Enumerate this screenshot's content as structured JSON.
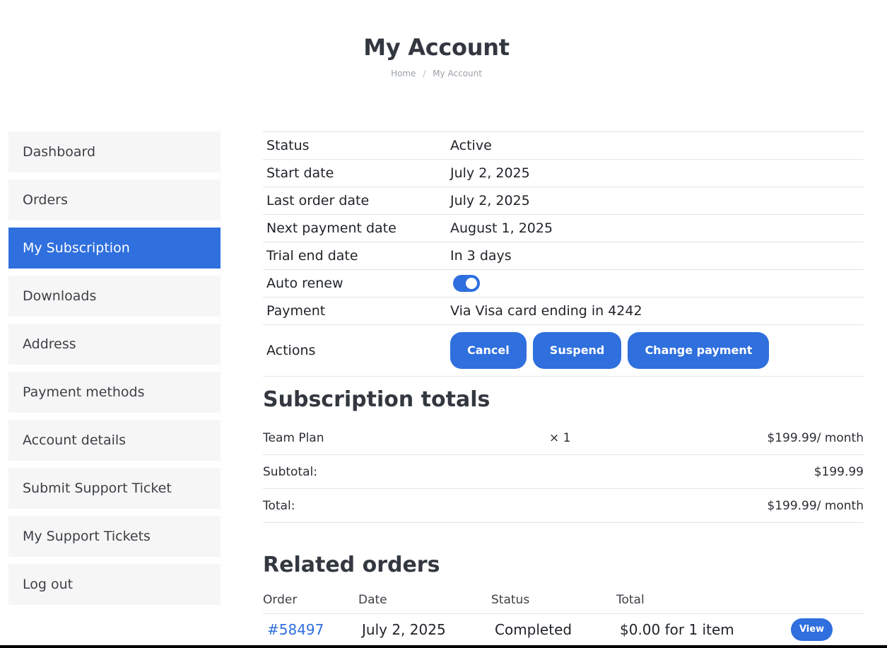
{
  "header": {
    "title": "My Account",
    "breadcrumb": [
      "Home",
      "My Account"
    ],
    "breadcrumb_sep": "/"
  },
  "sidebar": {
    "items": [
      {
        "label": "Dashboard"
      },
      {
        "label": "Orders"
      },
      {
        "label": "My Subscription"
      },
      {
        "label": "Downloads"
      },
      {
        "label": "Address"
      },
      {
        "label": "Payment methods"
      },
      {
        "label": "Account details"
      },
      {
        "label": "Submit Support Ticket"
      },
      {
        "label": "My Support Tickets"
      },
      {
        "label": "Log out"
      }
    ],
    "active": "My Subscription"
  },
  "subscription": {
    "rows": [
      {
        "label": "Status",
        "value": "Active"
      },
      {
        "label": "Start date",
        "value": "July 2, 2025"
      },
      {
        "label": "Last order date",
        "value": "July 2, 2025"
      },
      {
        "label": "Next payment date",
        "value": "August 1, 2025"
      },
      {
        "label": "Trial end date",
        "value": "In 3 days"
      },
      {
        "label": "Auto renew",
        "value": ""
      },
      {
        "label": "Payment",
        "value": "Via Visa card ending in 4242"
      }
    ],
    "auto_renew_on": true,
    "actions_label": "Actions",
    "actions": [
      "Cancel",
      "Suspend",
      "Change payment"
    ]
  },
  "totals": {
    "heading": "Subscription totals",
    "item_name": "Team Plan",
    "item_qty": "× 1",
    "item_price": "$199.99/ month",
    "subtotal_label": "Subtotal:",
    "subtotal_value": "$199.99",
    "total_label": "Total:",
    "total_value": "$199.99/ month"
  },
  "related_orders": {
    "heading": "Related orders",
    "columns": [
      "Order",
      "Date",
      "Status",
      "Total"
    ],
    "rows": [
      {
        "order": "#58497",
        "date": "July 2, 2025",
        "status": "Completed",
        "total": "$0.00 for 1 item",
        "action": "View"
      }
    ]
  },
  "colors": {
    "accent": "#2f6fde",
    "sidebar_bg": "#f6f6f6",
    "heading": "#333840"
  }
}
